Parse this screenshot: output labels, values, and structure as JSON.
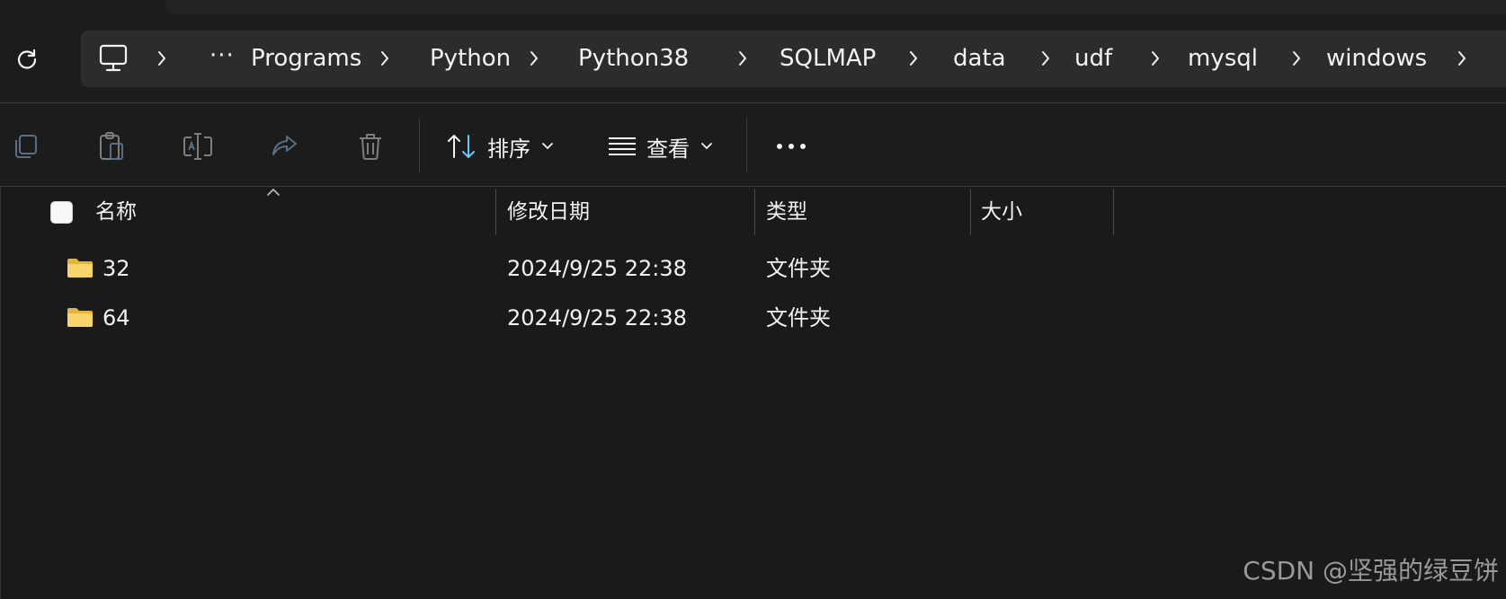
{
  "breadcrumb": {
    "ellipsis": "···",
    "items": [
      "Programs",
      "Python",
      "Python38",
      "SQLMAP",
      "data",
      "udf",
      "mysql",
      "windows"
    ]
  },
  "toolbar": {
    "sort_label": "排序",
    "view_label": "查看"
  },
  "columns": {
    "name": "名称",
    "modified": "修改日期",
    "type": "类型",
    "size": "大小"
  },
  "files": [
    {
      "name": "32",
      "modified": "2024/9/25 22:38",
      "type": "文件夹",
      "size": ""
    },
    {
      "name": "64",
      "modified": "2024/9/25 22:38",
      "type": "文件夹",
      "size": ""
    }
  ],
  "watermark": "CSDN @坚强的绿豆饼",
  "icons": {
    "refresh": "refresh-icon",
    "this_pc": "monitor-icon",
    "copy": "copy-icon",
    "paste": "paste-icon",
    "rename": "rename-icon",
    "share": "share-icon",
    "delete": "trash-icon",
    "sort": "sort-icon",
    "view": "view-lines-icon",
    "more": "more-icon",
    "folder": "folder-icon"
  },
  "colors": {
    "background": "#1a1a1a",
    "toolbar": "#1c1c1c",
    "address_box": "#2c2c2c",
    "accent": "#60cdff",
    "folder": "#f3c74a"
  }
}
